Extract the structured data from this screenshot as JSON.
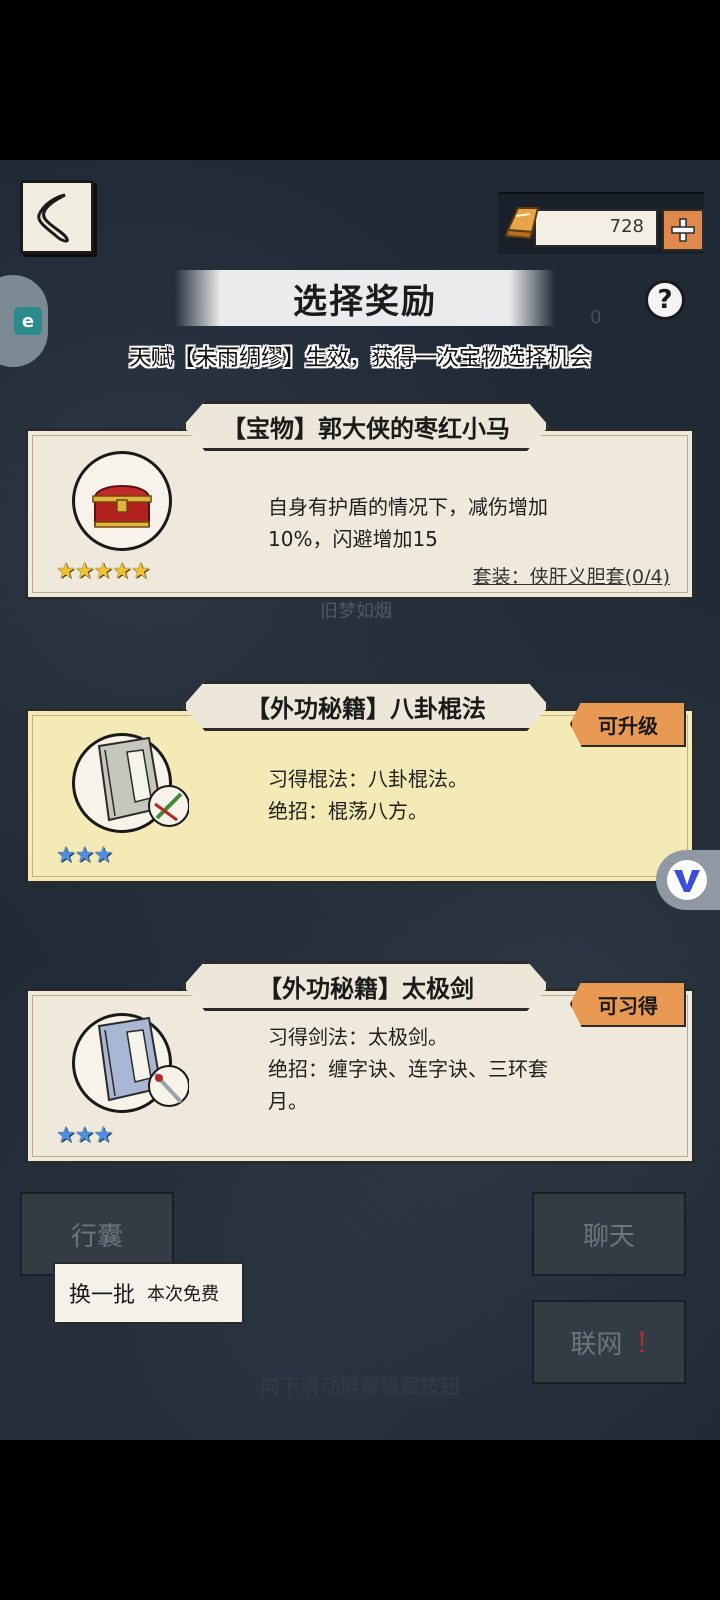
{
  "header": {
    "back_icon": "back-arrow-icon",
    "currency": {
      "icon": "gold-ingot-icon",
      "value": "728",
      "add_icon": "plus-icon"
    },
    "title": "选择奖励",
    "help_icon": "question-mark-icon",
    "bg_counter": "0",
    "subtitle": "天赋【未雨绸缪】生效，获得一次宝物选择机会"
  },
  "cards": [
    {
      "title": "【宝物】郭大侠的枣红小马",
      "icon": "treasure-chest-icon",
      "stars": "★★★★★",
      "star_color": "#f1c232",
      "desc_line1": "自身有护盾的情况下，减伤增加",
      "desc_line2": "10%，闪避增加15",
      "set_link": "套装：侠肝义胆套(0/4)"
    },
    {
      "title": "【外功秘籍】八卦棍法",
      "icon": "scroll-book-icon",
      "stars": "★★★",
      "star_color": "#4f8fe0",
      "badge": "可升级",
      "desc_line1": "习得棍法：八卦棍法。",
      "desc_line2": "绝招：棍荡八方。"
    },
    {
      "title": "【外功秘籍】太极剑",
      "icon": "scroll-book-icon",
      "stars": "★★★",
      "star_color": "#4f8fe0",
      "badge": "可习得",
      "desc_line1": "习得剑法：太极剑。",
      "desc_line2": "绝招：缠字诀、连字诀、三环套",
      "desc_line3": "月。"
    }
  ],
  "background": {
    "faded_text": "旧梦如烟",
    "bag_button": "行囊",
    "chat_button": "聊天",
    "network_button": "联网",
    "scroll_hint": "向下滑动屏幕隐藏按钮"
  },
  "refresh": {
    "label": "换一批",
    "sub_label": "本次免费"
  },
  "overlay": {
    "v_icon": "v-floating-icon"
  }
}
